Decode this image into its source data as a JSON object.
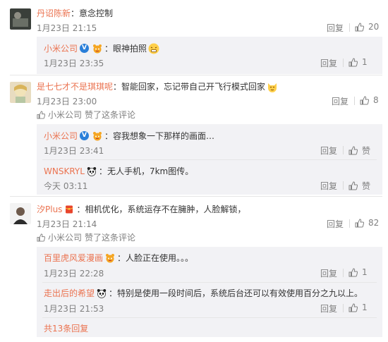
{
  "comments": [
    {
      "user": "丹诏陈新",
      "text": "意念控制",
      "time": "1月23日 21:15",
      "reply_label": "回复",
      "like_count": "20",
      "replies": [
        {
          "user": "小米公司",
          "text": "眼神拍照",
          "time": "1月23日 23:35",
          "reply_label": "回复",
          "like_count": "1"
        }
      ]
    },
    {
      "user": "是七七才不是琪琪呢",
      "text": "智能回家，忘记带自己开飞行模式回家",
      "time": "1月23日 23:00",
      "reply_label": "回复",
      "like_count": "8",
      "liked_by": "小米公司",
      "liked_suffix": "赞了这条评论",
      "replies": [
        {
          "user": "小米公司",
          "text": "容我想象一下那样的画面…",
          "time": "1月23日 23:41",
          "reply_label": "回复",
          "like_label": "赞"
        },
        {
          "user": "WNSKRYL",
          "text": "无人手机，7km图传。",
          "time": "今天 03:11",
          "reply_label": "回复",
          "like_label": "赞"
        }
      ]
    },
    {
      "user": "汐Plus",
      "text": "相机优化，系统运存不在臃肿，人脸解锁，",
      "time": "1月23日 21:14",
      "reply_label": "回复",
      "like_count": "82",
      "liked_by": "小米公司",
      "liked_suffix": "赞了这条评论",
      "replies": [
        {
          "user": "百里虎风爱漫画",
          "text": "人脸正在使用。。。",
          "time": "1月23日 22:28",
          "reply_label": "回复",
          "like_count": "1"
        },
        {
          "user": "走出后的希望",
          "text": "特别是使用一段时间后，系统后台还可以有效使用百分之九以上。",
          "time": "1月23日 21:53",
          "reply_label": "回复",
          "like_count": "1"
        }
      ],
      "more_replies": "共13条回复"
    }
  ],
  "colors": {
    "username": "#eb7350",
    "reply_bg": "#f2f2f5",
    "verified_blue": "#2a7fd9",
    "meta_gray": "#808080"
  },
  "icons": [
    "thumb-up-icon",
    "verified-v-icon",
    "vip-badge-icon",
    "panda-badge-icon",
    "red-packet-badge-icon",
    "grimace-emoji-icon",
    "cat-emoji-icon"
  ]
}
